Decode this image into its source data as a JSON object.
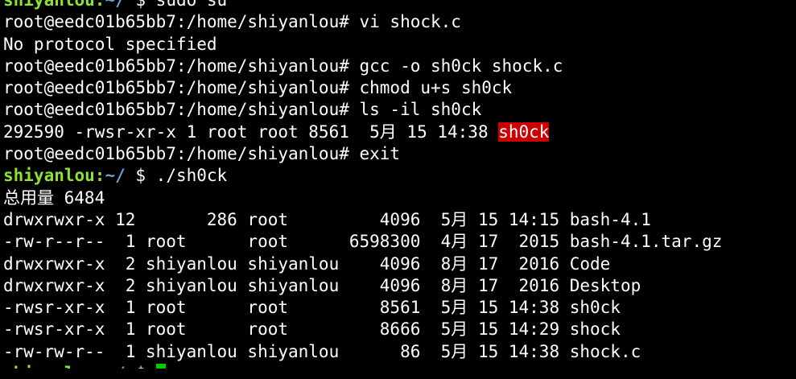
{
  "theme": {
    "background": "#000000",
    "foreground": "#ffffff",
    "user_color": "#8ae234",
    "path_color": "#729fcf",
    "highlight_bg": "#cc0000",
    "cursor_color": "#00cc00"
  },
  "terminal": {
    "lines": [
      [
        {
          "t": "shiyanlou",
          "c": "user"
        },
        {
          "t": ":",
          "c": "user"
        },
        {
          "t": "~/",
          "c": "path"
        },
        {
          "t": " $ sudo su"
        }
      ],
      [
        {
          "t": "root@eedc01b65bb7:/home/shiyanlou# vi shock.c"
        }
      ],
      [
        {
          "t": "No protocol specified"
        }
      ],
      [
        {
          "t": "root@eedc01b65bb7:/home/shiyanlou# gcc -o sh0ck shock.c"
        }
      ],
      [
        {
          "t": "root@eedc01b65bb7:/home/shiyanlou# chmod u+s sh0ck"
        }
      ],
      [
        {
          "t": "root@eedc01b65bb7:/home/shiyanlou# ls -il sh0ck"
        }
      ],
      [
        {
          "t": "292590 -rwsr-xr-x 1 root root 8561  5月 15 14:38 "
        },
        {
          "t": "sh0ck",
          "c": "hl"
        }
      ],
      [
        {
          "t": "root@eedc01b65bb7:/home/shiyanlou# exit"
        }
      ],
      [
        {
          "t": "shiyanlou",
          "c": "user"
        },
        {
          "t": ":",
          "c": "user"
        },
        {
          "t": "~/",
          "c": "path"
        },
        {
          "t": " $ ./sh0ck"
        }
      ],
      [
        {
          "t": "总用量 6484"
        }
      ],
      [
        {
          "t": "drwxrwxr-x 12       286 root         4096  5月 15 14:15 bash-4.1"
        }
      ],
      [
        {
          "t": "-rw-r--r--  1 root      root      6598300  4月 17  2015 bash-4.1.tar.gz"
        }
      ],
      [
        {
          "t": "drwxrwxr-x  2 shiyanlou shiyanlou    4096  8月 17  2016 Code"
        }
      ],
      [
        {
          "t": "drwxrwxr-x  2 shiyanlou shiyanlou    4096  8月 17  2016 Desktop"
        }
      ],
      [
        {
          "t": "-rwsr-xr-x  1 root      root         8561  5月 15 14:38 sh0ck"
        }
      ],
      [
        {
          "t": "-rwsr-xr-x  1 root      root         8666  5月 15 14:29 shock"
        }
      ],
      [
        {
          "t": "-rw-rw-r--  1 shiyanlou shiyanlou      86  5月 15 14:38 shock.c"
        }
      ],
      [
        {
          "t": "shiyanlou",
          "c": "user"
        },
        {
          "t": ":",
          "c": "user"
        },
        {
          "t": "~/",
          "c": "path"
        },
        {
          "t": " $ "
        },
        {
          "t": "",
          "c": "cursor"
        }
      ]
    ]
  }
}
